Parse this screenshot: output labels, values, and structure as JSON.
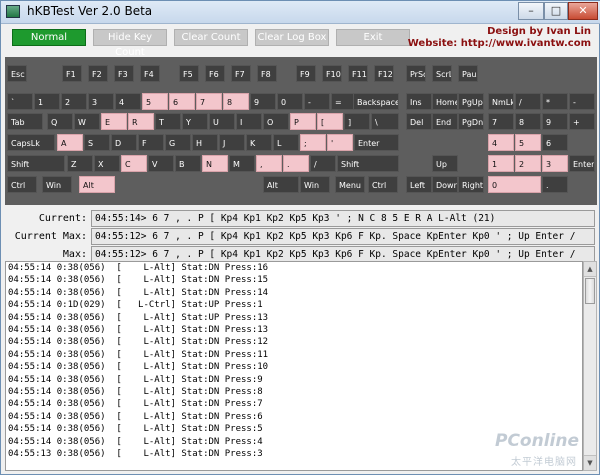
{
  "window": {
    "title": "hKBTest Ver 2.0 Beta",
    "minimize": "–",
    "maximize": "□",
    "close": "✕"
  },
  "toolbar": {
    "normal": "Normal",
    "hide_key_count": "Hide Key Count",
    "clear_count": "Clear Count",
    "clear_log_box": "Clear Log Box",
    "exit": "Exit"
  },
  "brand": {
    "line1": "Design by Ivan Lin",
    "line2": "Website: http://www.ivantw.com"
  },
  "keyboard": {
    "highlight_color": "#f3c6cc",
    "keys": [
      [
        "Esc",
        false
      ],
      [
        "F1",
        false
      ],
      [
        "F2",
        false
      ],
      [
        "F3",
        false
      ],
      [
        "F4",
        false
      ],
      [
        "F5",
        false
      ],
      [
        "F6",
        false
      ],
      [
        "F7",
        false
      ],
      [
        "F8",
        false
      ],
      [
        "F9",
        false
      ],
      [
        "F10",
        false
      ],
      [
        "F11",
        false
      ],
      [
        "F12",
        false
      ],
      [
        "PrScr",
        false
      ],
      [
        "ScrLk",
        false
      ],
      [
        "Pause",
        false
      ],
      [
        "`",
        false
      ],
      [
        "1",
        false
      ],
      [
        "2",
        false
      ],
      [
        "3",
        false
      ],
      [
        "4",
        false
      ],
      [
        "5",
        true
      ],
      [
        "6",
        true
      ],
      [
        "7",
        true
      ],
      [
        "8",
        true
      ],
      [
        "9",
        false
      ],
      [
        "0",
        false
      ],
      [
        "-",
        false
      ],
      [
        "=",
        false
      ],
      [
        "Backspace",
        false
      ],
      [
        "Ins",
        false
      ],
      [
        "Home",
        false
      ],
      [
        "PgUp",
        false
      ],
      [
        "NmLk",
        false
      ],
      [
        "/",
        false
      ],
      [
        "*",
        false
      ],
      [
        "-",
        false
      ],
      [
        "Tab",
        false
      ],
      [
        "Q",
        false
      ],
      [
        "W",
        false
      ],
      [
        "E",
        true
      ],
      [
        "R",
        true
      ],
      [
        "T",
        false
      ],
      [
        "Y",
        false
      ],
      [
        "U",
        false
      ],
      [
        "I",
        false
      ],
      [
        "O",
        false
      ],
      [
        "P",
        true
      ],
      [
        "[",
        true
      ],
      [
        "]",
        false
      ],
      [
        "\\",
        false
      ],
      [
        "Del",
        false
      ],
      [
        "End",
        false
      ],
      [
        "PgDn",
        false
      ],
      [
        "7",
        false
      ],
      [
        "8",
        false
      ],
      [
        "9",
        false
      ],
      [
        "+",
        false
      ],
      [
        "CapsLk",
        false
      ],
      [
        "A",
        true
      ],
      [
        "S",
        false
      ],
      [
        "D",
        false
      ],
      [
        "F",
        false
      ],
      [
        "G",
        false
      ],
      [
        "H",
        false
      ],
      [
        "J",
        false
      ],
      [
        "K",
        false
      ],
      [
        "L",
        false
      ],
      [
        ";",
        true
      ],
      [
        "'",
        true
      ],
      [
        "Enter",
        false
      ],
      [
        "4",
        true
      ],
      [
        "5",
        true
      ],
      [
        "6",
        false
      ],
      [
        "Shift",
        false
      ],
      [
        "Z",
        false
      ],
      [
        "X",
        false
      ],
      [
        "C",
        true
      ],
      [
        "V",
        false
      ],
      [
        "B",
        false
      ],
      [
        "N",
        true
      ],
      [
        "M",
        false
      ],
      [
        ",",
        true
      ],
      [
        ".",
        true
      ],
      [
        "/",
        false
      ],
      [
        "Shift",
        false
      ],
      [
        "Up",
        false
      ],
      [
        "1",
        true
      ],
      [
        "2",
        true
      ],
      [
        "3",
        true
      ],
      [
        "Enter",
        false
      ],
      [
        "Ctrl",
        false
      ],
      [
        "Win",
        false
      ],
      [
        "Alt",
        true
      ],
      [
        "Alt",
        false
      ],
      [
        "Win",
        false
      ],
      [
        "Menu",
        false
      ],
      [
        "Ctrl",
        false
      ],
      [
        "Left",
        false
      ],
      [
        "Down",
        false
      ],
      [
        "Right",
        false
      ],
      [
        "0",
        true
      ],
      [
        ".",
        false
      ]
    ]
  },
  "stats": {
    "current_label": "Current:",
    "current": "04:55:14> 6 7 , . P [ Kp4 Kp1 Kp2 Kp5 Kp3 ' ; N C 8 5 E R A L-Alt (21)",
    "current_max_label": "Current Max:",
    "current_max": "04:55:12> 6 7 , . P [ Kp4 Kp1 Kp2 Kp5 Kp3 Kp6 F Kp. Space KpEnter Kp0 ' ; Up Enter /",
    "max_label": "Max:",
    "max": "04:55:12> 6 7 , . P [ Kp4 Kp1 Kp2 Kp5 Kp3 Kp6 F Kp. Space KpEnter Kp0 ' ; Up Enter /"
  },
  "log": [
    "04:55:14 0:38(056)  [    L-Alt] Stat:DN Press:16",
    "04:55:14 0:38(056)  [    L-Alt] Stat:DN Press:15",
    "04:55:14 0:38(056)  [    L-Alt] Stat:DN Press:14",
    "04:55:14 0:1D(029)  [   L-Ctrl] Stat:UP Press:1",
    "04:55:14 0:38(056)  [    L-Alt] Stat:UP Press:13",
    "04:55:14 0:38(056)  [    L-Alt] Stat:DN Press:13",
    "04:55:14 0:38(056)  [    L-Alt] Stat:DN Press:12",
    "04:55:14 0:38(056)  [    L-Alt] Stat:DN Press:11",
    "04:55:14 0:38(056)  [    L-Alt] Stat:DN Press:10",
    "04:55:14 0:38(056)  [    L-Alt] Stat:DN Press:9",
    "04:55:14 0:38(056)  [    L-Alt] Stat:DN Press:8",
    "04:55:14 0:38(056)  [    L-Alt] Stat:DN Press:7",
    "04:55:14 0:38(056)  [    L-Alt] Stat:DN Press:6",
    "04:55:14 0:38(056)  [    L-Alt] Stat:DN Press:5",
    "04:55:14 0:38(056)  [    L-Alt] Stat:DN Press:4",
    "04:55:13 0:38(056)  [    L-Alt] Stat:DN Press:3"
  ],
  "watermark": {
    "line1": "PConline",
    "line2": "太平洋电脑网"
  }
}
